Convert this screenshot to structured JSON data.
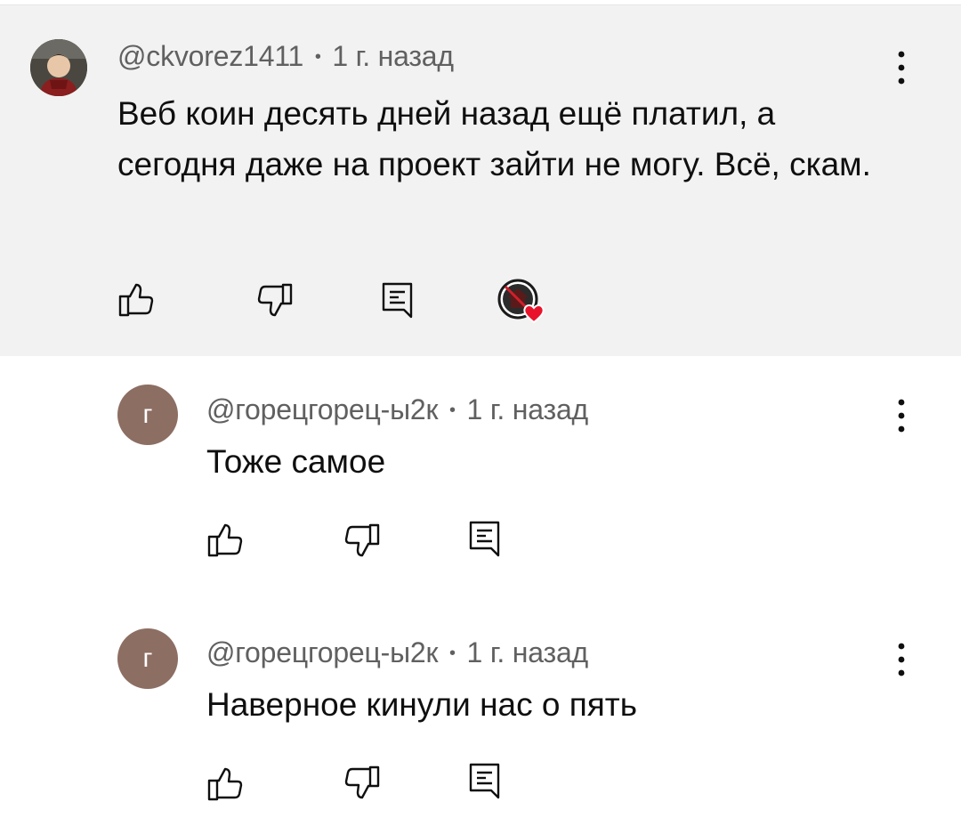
{
  "comments": [
    {
      "author": "@ckvorez1411",
      "time": "1 г. назад",
      "separator": "•",
      "text": "Веб коин десять дней назад ещё платил, а сегодня даже на проект зайти не могу. Всё, скам.",
      "has_creator_heart": true
    },
    {
      "author": "@горецгорец-ы2к",
      "time": "1 г. назад",
      "separator": "•",
      "avatar_letter": "г",
      "text": "Тоже самое"
    },
    {
      "author": "@горецгорец-ы2к",
      "time": "1 г. назад",
      "separator": "•",
      "avatar_letter": "г",
      "text": "Наверное кинули нас о пять"
    }
  ],
  "icons": [
    "like-icon",
    "dislike-icon",
    "reply-icon",
    "more-vert-icon",
    "creator-heart-icon"
  ],
  "colors": {
    "highlight_bg": "#f2f2f2",
    "avatar_letter_bg": "#8d6e63",
    "meta_text": "#606060",
    "heart": "#e8132a"
  }
}
